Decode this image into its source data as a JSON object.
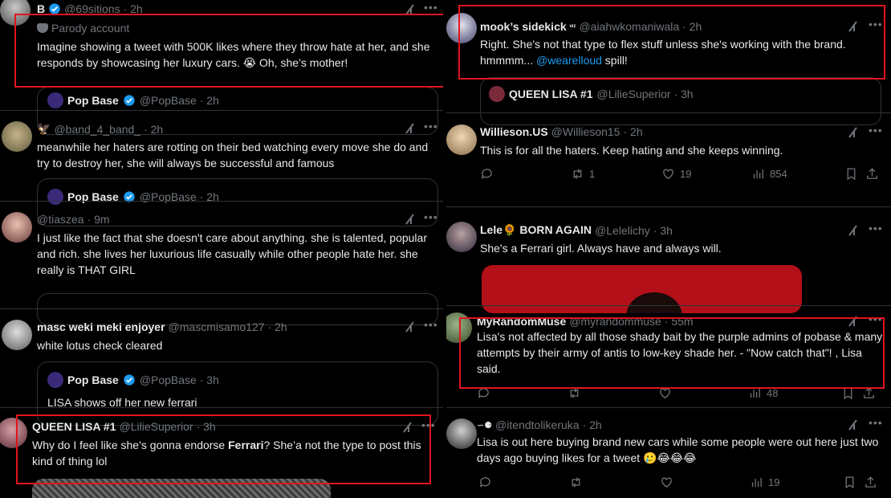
{
  "left": {
    "t1": {
      "name": "B",
      "handle": "@69sitions",
      "time": "· 2h",
      "label": "Parody account",
      "text": "Imagine showing a tweet with 500K likes where they throw hate at her, and she responds by showcasing her luxury cars. 😭 Oh, she’s mother!",
      "quote_name": "Pop Base",
      "quote_handle": "@PopBase · 2h"
    },
    "t2": {
      "handle": "@band_4_band_",
      "time": "· 2h",
      "text": "meanwhile her haters are rotting on their bed watching every move she do and try to destroy her, she will always be successful and famous",
      "quote_name": "Pop Base",
      "quote_handle": "@PopBase · 2h"
    },
    "t3": {
      "handle": "@tiaszea",
      "time": "· 9m",
      "text": "I just like the fact that she doesn't care about anything. she is talented, popular and rich. she lives her luxurious life casually while other people hate her. she really is THAT GIRL"
    },
    "t4": {
      "name": "masc weki meki enjoyer",
      "handle": "@mascmisamo127",
      "time": "· 2h",
      "text": "white lotus check cleared",
      "quote_name": "Pop Base",
      "quote_handle": "@PopBase · 3h",
      "quote_text": "LISA shows off her new ferrari"
    },
    "t5": {
      "name": "QUEEN LISA #1",
      "handle": "@LilieSuperior",
      "time": "· 3h",
      "text_a": "Why do I feel like she’s gonna endorse ",
      "text_b": "Ferrari",
      "text_c": "? She’a not the type to post this kind of thing lol"
    }
  },
  "right": {
    "t1": {
      "name": "mook’s sidekick",
      "handle": "@aiahwkomaniwala",
      "time": "· 2h",
      "text_a": "Right. She's not that type to flex stuff unless she's working with the brand. hmmmm... ",
      "mention": "@wearelloud",
      "text_b": " spill!",
      "quote_name": "QUEEN LISA #1",
      "quote_handle": "@LilieSuperior · 3h"
    },
    "t2": {
      "name": "Willieson.US",
      "handle": "@Willieson15",
      "time": "· 2h",
      "text": "This is for all the haters.   Keep hating and she keeps winning.",
      "retweets": "1",
      "likes": "19",
      "views": "854"
    },
    "t3": {
      "name": "Lele🌻 BORN AGAIN",
      "handle": "@Lelelichy",
      "time": "· 3h",
      "text": "She's a Ferrari girl. Always have and always will."
    },
    "t4": {
      "name": "MyRandomMuse",
      "handle": "@myrandommuse",
      "time": "· 55m",
      "text": "Lisa's not affected by all those shady bait by the purple admins of pobase & many attempts by their army of antis to low-key shade her. - \"Now catch that\"! , Lisa said.",
      "views": "48"
    },
    "t5": {
      "handle": "@itendtolikeruka",
      "time": "· 2h",
      "text": "Lisa is out here buying brand new cars while some people were out here just two days ago buying likes for a tweet 🥲😂😂😂",
      "views": "19"
    }
  }
}
